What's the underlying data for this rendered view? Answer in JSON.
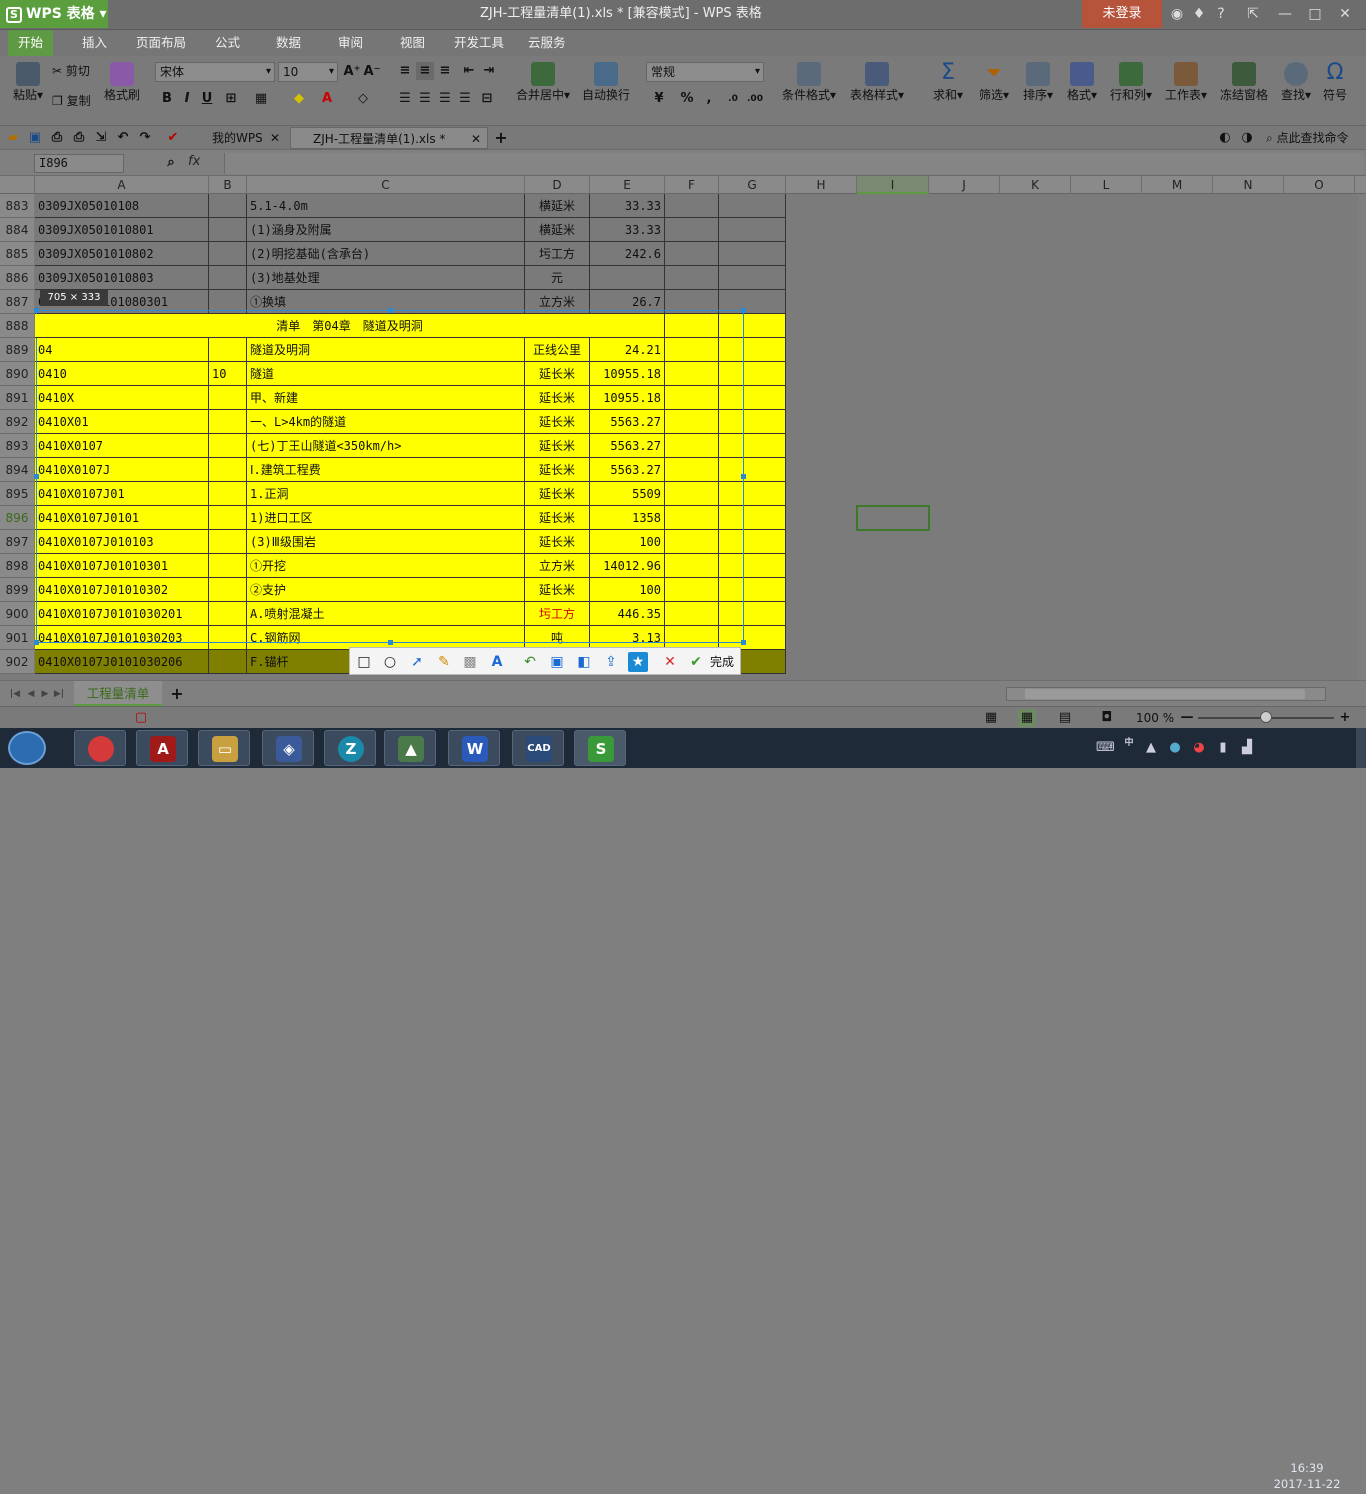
{
  "app": {
    "name": "WPS 表格",
    "title": "ZJH-工程量清单(1).xls * [兼容模式] - WPS 表格",
    "login": "未登录"
  },
  "menus": [
    "开始",
    "插入",
    "页面布局",
    "公式",
    "数据",
    "审阅",
    "视图",
    "开发工具",
    "云服务"
  ],
  "ribbon": {
    "paste": "粘贴",
    "cut": "剪切",
    "copy": "复制",
    "format_painter": "格式刷",
    "font_name": "宋体",
    "font_size": "10",
    "merge": "合并居中",
    "wrap": "自动换行",
    "number_format": "常规",
    "cond_format": "条件格式",
    "table_style": "表格样式",
    "sum": "求和",
    "filter": "筛选",
    "sort": "排序",
    "format": "格式",
    "rowcol": "行和列",
    "sheet": "工作表",
    "freeze": "冻结窗格",
    "find": "查找",
    "symbol": "符号"
  },
  "tabs": {
    "my_wps": "我的WPS",
    "doc": "ZJH-工程量清单(1).xls *",
    "search": "点此查找命令"
  },
  "formula": {
    "namebox": "I896",
    "fx": "fx"
  },
  "columns": [
    "A",
    "B",
    "C",
    "D",
    "E",
    "F",
    "G",
    "H",
    "I",
    "J",
    "K",
    "L",
    "M",
    "N",
    "O"
  ],
  "rows": [
    {
      "n": "883",
      "a": "0309JX05010108",
      "b": "",
      "c": "5.1-4.0m",
      "d": "横延米",
      "e": "33.33"
    },
    {
      "n": "884",
      "a": "0309JX0501010801",
      "b": "",
      "c": "(1)涵身及附属",
      "d": "横延米",
      "e": "33.33"
    },
    {
      "n": "885",
      "a": "0309JX0501010802",
      "b": "",
      "c": "(2)明挖基础(含承台)",
      "d": "圬工方",
      "e": "242.6"
    },
    {
      "n": "886",
      "a": "0309JX0501010803",
      "b": "",
      "c": "(3)地基处理",
      "d": "元",
      "e": ""
    },
    {
      "n": "887",
      "a": "0309JX0501010803​01",
      "b": "",
      "c": "①换填",
      "d": "立方米",
      "e": "26.7"
    },
    {
      "n": "888",
      "a": "",
      "b": "",
      "c": "清单　第04章　隧道及明洞",
      "d": "",
      "e": ""
    },
    {
      "n": "889",
      "a": "04",
      "b": "",
      "c": "隧道及明洞",
      "d": "正线公里",
      "e": "24.21"
    },
    {
      "n": "890",
      "a": "0410",
      "b": "10",
      "c": "隧道",
      "d": "延长米",
      "e": "10955.18"
    },
    {
      "n": "891",
      "a": "0410X",
      "b": "",
      "c": "甲、新建",
      "d": "延长米",
      "e": "10955.18"
    },
    {
      "n": "892",
      "a": "0410X01",
      "b": "",
      "c": "一、L>4km的隧道",
      "d": "延长米",
      "e": "5563.27"
    },
    {
      "n": "893",
      "a": "0410X0107",
      "b": "",
      "c": "(七)丁王山隧道<350km/h>",
      "d": "延长米",
      "e": "5563.27"
    },
    {
      "n": "894",
      "a": "0410X0107J",
      "b": "",
      "c": "Ⅰ.建筑工程费",
      "d": "延长米",
      "e": "5563.27"
    },
    {
      "n": "895",
      "a": "0410X0107J01",
      "b": "",
      "c": "1.正洞",
      "d": "延长米",
      "e": "5509"
    },
    {
      "n": "896",
      "a": "0410X0107J0101",
      "b": "",
      "c": "1)进口工区",
      "d": "延长米",
      "e": "1358"
    },
    {
      "n": "897",
      "a": "0410X0107J010103",
      "b": "",
      "c": "(3)Ⅲ级围岩",
      "d": "延长米",
      "e": "100"
    },
    {
      "n": "898",
      "a": "0410X0107J01010301",
      "b": "",
      "c": "①开挖",
      "d": "立方米",
      "e": "14012.96"
    },
    {
      "n": "899",
      "a": "0410X0107J01010302",
      "b": "",
      "c": "②支护",
      "d": "延长米",
      "e": "100"
    },
    {
      "n": "900",
      "a": "0410X0107J0101030201",
      "b": "",
      "c": "A.喷射混凝土",
      "d": "圬工方",
      "e": "446.35"
    },
    {
      "n": "901",
      "a": "0410X0107J0101030203",
      "b": "",
      "c": "C.钢筋网",
      "d": "吨",
      "e": "3.13"
    },
    {
      "n": "902",
      "a": "0410X0107J0101030206",
      "b": "",
      "c": "F.锚杆",
      "d": "",
      "e": ""
    }
  ],
  "capture": {
    "size": "705 × 333",
    "done": "完成"
  },
  "sheet": {
    "name": "工程量清单"
  },
  "status": {
    "zoom": "100 %"
  },
  "clock": {
    "time": "16:39",
    "date": "2017-11-22"
  },
  "colors": {
    "accent": "#5e9a44",
    "highlight": "#ffff00",
    "red_text": "#d40000"
  }
}
